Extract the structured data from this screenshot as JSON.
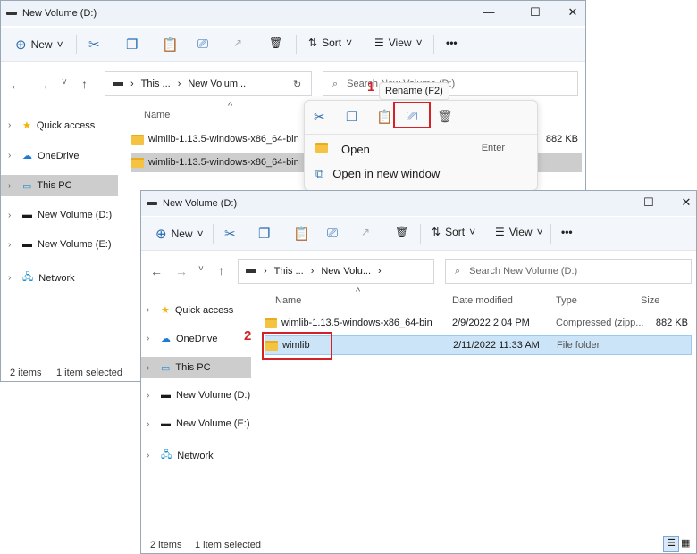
{
  "back": {
    "title": "New Volume (D:)",
    "toolbar": {
      "new": "New",
      "sort": "Sort",
      "view": "View",
      "more": "•••"
    },
    "address": [
      "This ...",
      "New Volum..."
    ],
    "search": "Search New Volume (D:)",
    "sidebar": [
      "Quick access",
      "OneDrive",
      "This PC",
      "New Volume (D:)",
      "New Volume (E:)",
      "Network"
    ],
    "header": {
      "name": "Name"
    },
    "rows": [
      {
        "name": "wimlib-1.13.5-windows-x86_64-bin",
        "size": "882 KB"
      },
      {
        "name": "wimlib-1.13.5-windows-x86_64-bin"
      }
    ],
    "status": {
      "items": "2 items",
      "selected": "1 item selected"
    }
  },
  "context": {
    "tooltip": "Rename (F2)",
    "items": [
      {
        "label": "Open",
        "shortcut": "Enter"
      },
      {
        "label": "Open in new window"
      }
    ]
  },
  "front": {
    "title": "New Volume (D:)",
    "toolbar": {
      "new": "New",
      "sort": "Sort",
      "view": "View",
      "more": "•••"
    },
    "address": [
      "This ...",
      "New Volu..."
    ],
    "search": "Search New Volume (D:)",
    "sidebar": [
      "Quick access",
      "OneDrive",
      "This PC",
      "New Volume (D:)",
      "New Volume (E:)",
      "Network"
    ],
    "header": {
      "name": "Name",
      "date": "Date modified",
      "type": "Type",
      "size": "Size"
    },
    "rows": [
      {
        "name": "wimlib-1.13.5-windows-x86_64-bin",
        "date": "2/9/2022 2:04 PM",
        "type": "Compressed (zipp...",
        "size": "882 KB"
      },
      {
        "name": "wimlib",
        "date": "2/11/2022 11:33 AM",
        "type": "File folder",
        "size": ""
      }
    ],
    "status": {
      "items": "2 items",
      "selected": "1 item selected"
    }
  },
  "annotations": [
    "1",
    "2"
  ]
}
